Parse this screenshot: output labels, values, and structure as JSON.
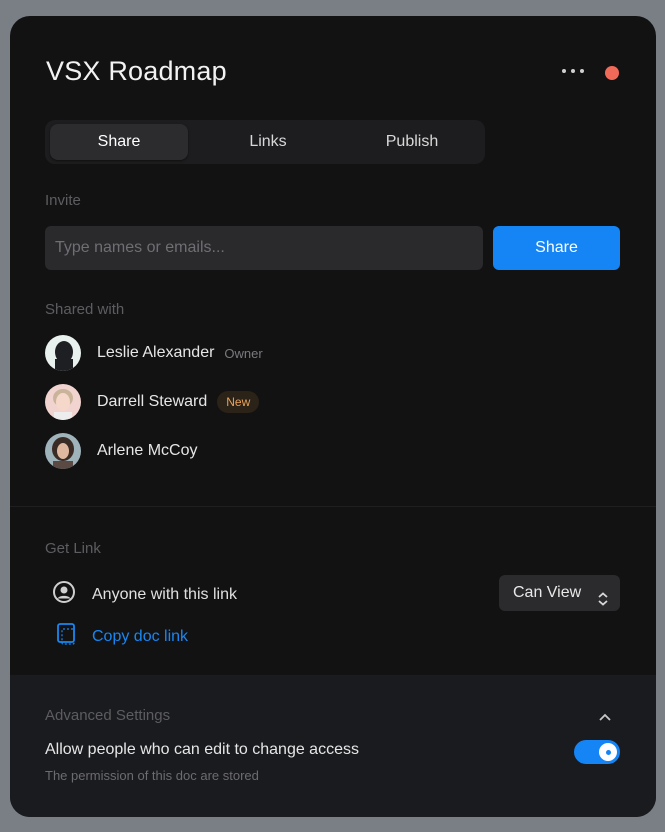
{
  "header": {
    "title": "VSX Roadmap",
    "more_icon": "more-horizontal-icon",
    "status_color": "#f06a5a"
  },
  "tabs": [
    {
      "label": "Share",
      "active": true
    },
    {
      "label": "Links",
      "active": false
    },
    {
      "label": "Publish",
      "active": false
    }
  ],
  "invite": {
    "label": "Invite",
    "placeholder": "Type names or emails...",
    "button_label": "Share"
  },
  "shared_with": {
    "label": "Shared with",
    "people": [
      {
        "name": "Leslie Alexander",
        "tag": "Owner"
      },
      {
        "name": "Darrell Steward",
        "badge": "New"
      },
      {
        "name": "Arlene McCoy"
      }
    ]
  },
  "get_link": {
    "label": "Get Link",
    "access_text": "Anyone with this link",
    "permission": "Can View",
    "copy_label": "Copy doc link"
  },
  "advanced": {
    "title": "Advanced Settings",
    "allow_text": "Allow people who can edit to change access",
    "permission_note": "The permission of this doc are stored",
    "toggle_on": true
  },
  "colors": {
    "accent": "#1584f5",
    "badge_text": "#e8a45a"
  }
}
